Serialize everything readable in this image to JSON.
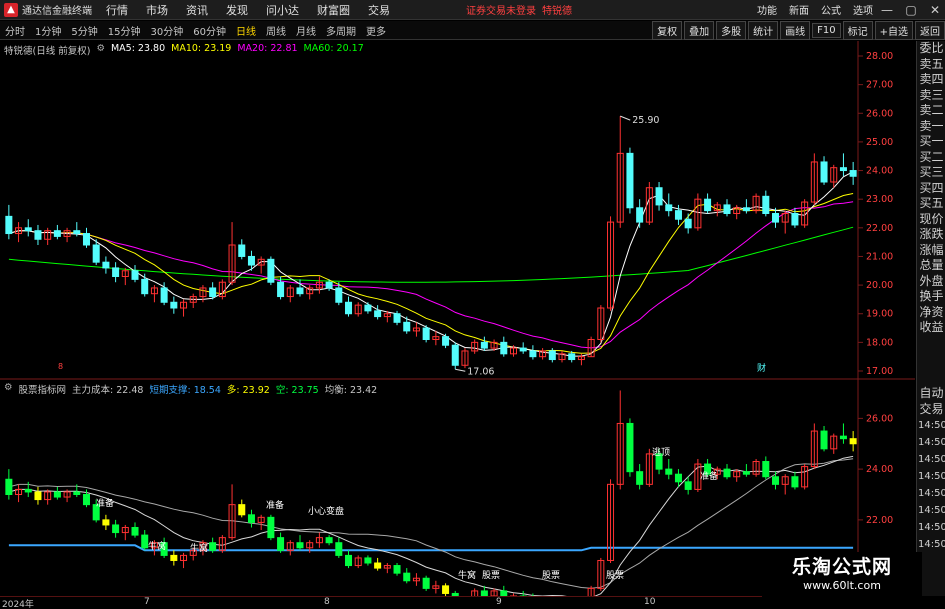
{
  "window": {
    "app_title": "通达信金融终端",
    "menu": [
      "行情",
      "市场",
      "资讯",
      "发现",
      "问小达",
      "财富圈",
      "交易"
    ],
    "notice": "证券交易未登录",
    "user": "特锐德",
    "right_menu": [
      "功能",
      "新面",
      "公式",
      "选项"
    ],
    "window_buttons": [
      "—",
      "▢",
      "✕"
    ]
  },
  "tabs": {
    "periods": [
      "分时",
      "1分钟",
      "5分钟",
      "15分钟",
      "30分钟",
      "60分钟",
      "日线",
      "周线",
      "月线",
      "多周期",
      "更多"
    ],
    "active": "日线",
    "right_buttons": [
      "复权",
      "叠加",
      "多股",
      "统计",
      "画线",
      "F10",
      "标记",
      "+自选",
      "返回"
    ]
  },
  "main_chart": {
    "legend": {
      "title": "特锐德(日线 前复权)",
      "ma5": "MA5: 23.80",
      "ma10": "MA10: 23.19",
      "ma20": "MA20: 22.81",
      "ma60": "MA60: 20.17"
    },
    "price_labels": [
      "28.00",
      "27.00",
      "26.00",
      "25.00",
      "24.00",
      "23.00",
      "22.00",
      "21.00",
      "20.00",
      "19.00",
      "18.00",
      "17.00"
    ],
    "high_label": "25.90",
    "low_label": "17.06",
    "marker_8": "8",
    "marker_cai": "财"
  },
  "sub_chart": {
    "legend": {
      "title": "股票指标网",
      "cost": "主力成本: 22.48",
      "support": "短期支撑: 18.54",
      "long": "多: 23.92",
      "short": "空: 23.75",
      "balance": "均衡: 23.42"
    },
    "price_labels": [
      "26.00",
      "24.00",
      "22.00",
      "20.00"
    ],
    "annotations": {
      "top_escape": "逃顶",
      "prepare1": "准备",
      "prepare2": "准备",
      "prepare3": "准备",
      "caution": "小心变盘",
      "cow1": "牛窝",
      "cow2": "牛窝",
      "cow3": "牛窝",
      "stock1": "股票",
      "stock2": "股票",
      "stock3": "股票"
    }
  },
  "side_panel": {
    "items": [
      "委比",
      "卖五",
      "卖四",
      "卖三",
      "卖二",
      "卖一",
      "买一",
      "买二",
      "买三",
      "买四",
      "买五",
      "现价",
      "涨跌",
      "涨幅",
      "总量",
      "外盘",
      "换手",
      "净资",
      "收益"
    ],
    "lower_items": [
      "自动",
      "交易"
    ],
    "times": [
      "14:50",
      "14:50",
      "14:50",
      "14:50",
      "14:50",
      "14:50",
      "14:50",
      "14:50"
    ]
  },
  "date_axis": {
    "labels": [
      "2024年",
      "7",
      "8",
      "9",
      "10"
    ]
  },
  "watermark": {
    "title": "乐淘公式网",
    "url": "www.60lt.com"
  },
  "colors": {
    "up": "#ff3232",
    "down": "#54fcfc",
    "ma5": "#ffffff",
    "ma10": "#ffff00",
    "ma20": "#ff00ff",
    "ma60": "#00ff00",
    "sub_green": "#00ff40",
    "sub_yellow": "#ffff00",
    "support_line": "#3ba7ff"
  },
  "chart_data": {
    "type": "candlestick",
    "price_axis": [
      17,
      28
    ],
    "candles": [
      [
        22.4,
        22.8,
        21.6,
        21.8
      ],
      [
        21.8,
        22.2,
        21.5,
        22.0
      ],
      [
        22.0,
        22.3,
        21.7,
        21.9
      ],
      [
        21.9,
        22.1,
        21.4,
        21.6
      ],
      [
        21.6,
        22.0,
        21.4,
        21.9
      ],
      [
        21.9,
        22.1,
        21.6,
        21.7
      ],
      [
        21.7,
        22.0,
        21.5,
        21.9
      ],
      [
        21.9,
        22.2,
        21.7,
        21.8
      ],
      [
        21.8,
        22.0,
        21.3,
        21.4
      ],
      [
        21.4,
        21.6,
        20.7,
        20.8
      ],
      [
        20.8,
        21.0,
        20.4,
        20.6
      ],
      [
        20.6,
        20.8,
        20.1,
        20.3
      ],
      [
        20.3,
        20.6,
        20.0,
        20.5
      ],
      [
        20.5,
        20.7,
        20.1,
        20.2
      ],
      [
        20.2,
        20.4,
        19.6,
        19.7
      ],
      [
        19.7,
        20.0,
        19.4,
        19.9
      ],
      [
        19.9,
        20.1,
        19.3,
        19.4
      ],
      [
        19.4,
        19.6,
        19.0,
        19.2
      ],
      [
        19.2,
        19.5,
        18.9,
        19.4
      ],
      [
        19.4,
        19.7,
        19.2,
        19.6
      ],
      [
        19.6,
        20.0,
        19.4,
        19.9
      ],
      [
        19.9,
        20.1,
        19.5,
        19.6
      ],
      [
        19.6,
        20.2,
        19.5,
        20.1
      ],
      [
        20.1,
        22.2,
        20.0,
        21.4
      ],
      [
        21.4,
        21.6,
        20.9,
        21.0
      ],
      [
        21.0,
        21.2,
        20.5,
        20.7
      ],
      [
        20.7,
        21.0,
        20.4,
        20.9
      ],
      [
        20.9,
        21.0,
        20.0,
        20.1
      ],
      [
        20.1,
        20.3,
        19.5,
        19.6
      ],
      [
        19.6,
        20.0,
        19.4,
        19.9
      ],
      [
        19.9,
        20.2,
        19.6,
        19.7
      ],
      [
        19.7,
        20.0,
        19.5,
        19.9
      ],
      [
        19.9,
        20.3,
        19.7,
        20.1
      ],
      [
        20.1,
        20.2,
        19.8,
        19.9
      ],
      [
        19.9,
        20.1,
        19.3,
        19.4
      ],
      [
        19.4,
        19.6,
        18.9,
        19.0
      ],
      [
        19.0,
        19.4,
        18.9,
        19.3
      ],
      [
        19.3,
        19.4,
        19.0,
        19.1
      ],
      [
        19.1,
        19.3,
        18.8,
        18.9
      ],
      [
        18.9,
        19.1,
        18.7,
        19.0
      ],
      [
        19.0,
        19.1,
        18.6,
        18.7
      ],
      [
        18.7,
        18.9,
        18.3,
        18.4
      ],
      [
        18.4,
        18.7,
        18.2,
        18.5
      ],
      [
        18.5,
        18.6,
        18.0,
        18.1
      ],
      [
        18.1,
        18.4,
        17.9,
        18.2
      ],
      [
        18.2,
        18.3,
        17.8,
        17.9
      ],
      [
        17.9,
        18.0,
        17.06,
        17.2
      ],
      [
        17.2,
        17.8,
        17.1,
        17.7
      ],
      [
        17.7,
        18.1,
        17.6,
        18.0
      ],
      [
        18.0,
        18.2,
        17.7,
        17.8
      ],
      [
        17.8,
        18.1,
        17.7,
        18.0
      ],
      [
        18.0,
        18.2,
        17.5,
        17.6
      ],
      [
        17.6,
        17.9,
        17.5,
        17.8
      ],
      [
        17.8,
        18.0,
        17.6,
        17.7
      ],
      [
        17.7,
        17.9,
        17.4,
        17.5
      ],
      [
        17.5,
        17.8,
        17.4,
        17.7
      ],
      [
        17.7,
        17.8,
        17.3,
        17.4
      ],
      [
        17.4,
        17.7,
        17.3,
        17.6
      ],
      [
        17.6,
        17.7,
        17.3,
        17.4
      ],
      [
        17.4,
        17.6,
        17.2,
        17.5
      ],
      [
        17.5,
        18.2,
        17.5,
        18.1
      ],
      [
        18.1,
        19.3,
        18.0,
        19.2
      ],
      [
        19.2,
        22.4,
        19.1,
        22.2
      ],
      [
        22.2,
        25.9,
        22.0,
        24.6
      ],
      [
        24.6,
        24.8,
        22.5,
        22.7
      ],
      [
        22.7,
        23.0,
        22.0,
        22.2
      ],
      [
        22.2,
        23.6,
        22.1,
        23.4
      ],
      [
        23.4,
        23.6,
        22.6,
        22.8
      ],
      [
        22.8,
        23.2,
        22.4,
        22.6
      ],
      [
        22.6,
        22.8,
        22.1,
        22.3
      ],
      [
        22.3,
        22.5,
        21.8,
        22.0
      ],
      [
        22.0,
        23.2,
        21.9,
        23.0
      ],
      [
        23.0,
        23.2,
        22.5,
        22.6
      ],
      [
        22.6,
        22.9,
        22.4,
        22.8
      ],
      [
        22.8,
        23.0,
        22.4,
        22.5
      ],
      [
        22.5,
        22.8,
        22.3,
        22.7
      ],
      [
        22.7,
        23.0,
        22.5,
        22.6
      ],
      [
        22.6,
        23.2,
        22.5,
        23.1
      ],
      [
        23.1,
        23.3,
        22.4,
        22.5
      ],
      [
        22.5,
        22.7,
        22.0,
        22.2
      ],
      [
        22.2,
        22.6,
        21.8,
        22.5
      ],
      [
        22.5,
        22.7,
        22.0,
        22.1
      ],
      [
        22.1,
        23.0,
        22.0,
        22.9
      ],
      [
        22.9,
        24.6,
        22.8,
        24.3
      ],
      [
        24.3,
        24.5,
        23.5,
        23.6
      ],
      [
        23.6,
        24.2,
        23.4,
        24.1
      ],
      [
        24.1,
        24.6,
        23.8,
        24.0
      ],
      [
        24.0,
        24.3,
        23.5,
        23.8
      ]
    ],
    "x_ticks": [
      "2024年",
      "7",
      "8",
      "9",
      "10"
    ],
    "ma_series": [
      {
        "name": "MA5",
        "value": 23.8
      },
      {
        "name": "MA10",
        "value": 23.19
      },
      {
        "name": "MA20",
        "value": 22.81
      },
      {
        "name": "MA60",
        "value": 20.17
      }
    ],
    "sub_axis": [
      19,
      27
    ]
  }
}
